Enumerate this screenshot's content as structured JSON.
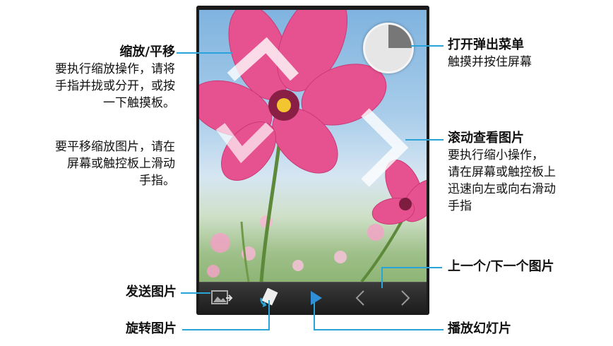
{
  "callouts": {
    "zoom_pan": {
      "title": "缩放/平移",
      "lines": [
        "要执行缩放操作，请将",
        "手指并拢或分开，或按",
        "一下触摸板。"
      ]
    },
    "pan_zoomed": {
      "lines": [
        "要平移缩放图片，请在",
        "屏幕或触控板上滑动",
        "手指。"
      ]
    },
    "popup_menu": {
      "title": "打开弹出菜单",
      "lines": [
        "触摸并按住屏幕"
      ]
    },
    "scroll_pictures": {
      "title": "滚动查看图片",
      "lines": [
        "要执行缩小操作，",
        "请在屏幕或触控板上",
        "迅速向左或向右滑动",
        "手指"
      ]
    },
    "prev_next": {
      "title": "上一个/下一个图片"
    },
    "send_picture": {
      "title": "发送图片"
    },
    "rotate_picture": {
      "title": "旋转图片"
    },
    "slideshow": {
      "title": "播放幻灯片"
    }
  },
  "colors": {
    "leader": "#2aa3d8",
    "petal": "#e6518f",
    "play_button": "#2f8fd8"
  },
  "toolbar_icons": [
    "send-picture-icon",
    "rotate-picture-icon",
    "play-icon",
    "previous-icon",
    "next-icon"
  ]
}
